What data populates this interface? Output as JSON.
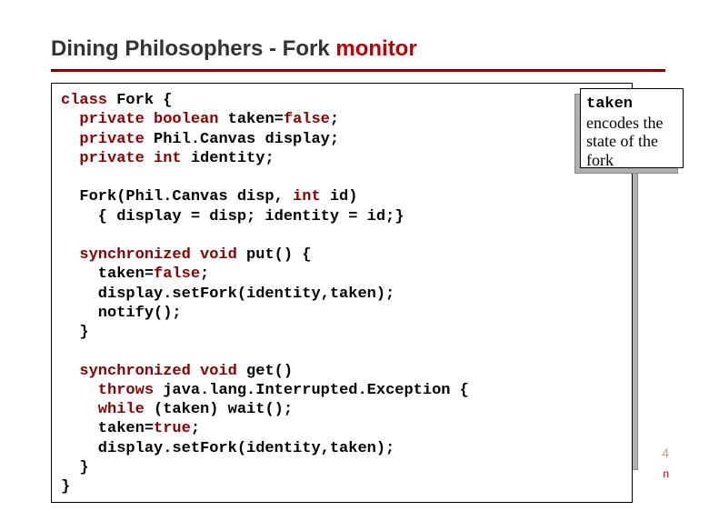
{
  "title": {
    "prefix": "Dining Philosophers - Fork ",
    "highlight": "monitor"
  },
  "code": {
    "l1a": "class",
    "l1b": " Fork {",
    "l2a": "  private",
    "l2b": " ",
    "l2c": "boolean",
    "l2d": " taken=",
    "l2e": "false",
    "l2f": ";",
    "l3a": "  private",
    "l3b": " Phil.Canvas display;",
    "l4a": "  private",
    "l4b": " ",
    "l4c": "int",
    "l4d": " identity;",
    "l5": "",
    "l6a": "  Fork(Phil.Canvas disp, ",
    "l6b": "int",
    "l6c": " id)",
    "l7": "    { display = disp; identity = id;}",
    "l8": "",
    "l9a": "  synchronized",
    "l9b": " ",
    "l9c": "void",
    "l9d": " put() {",
    "l10a": "    taken=",
    "l10b": "false",
    "l10c": ";",
    "l11": "    display.setFork(identity,taken);",
    "l12": "    notify();",
    "l13": "  }",
    "l14": "",
    "l15a": "  synchronized",
    "l15b": " ",
    "l15c": "void",
    "l15d": " get()",
    "l16a": "    throws",
    "l16b": " java.lang.Interrupted.Exception {",
    "l17a": "    while",
    "l17b": " (taken) wait();",
    "l18a": "    taken=",
    "l18b": "true",
    "l18c": ";",
    "l19": "    display.setFork(identity,taken);",
    "l20": "  }",
    "l21": "}"
  },
  "note": {
    "code_word": "taken",
    "rest": " encodes the state of the fork"
  },
  "page_num": "4",
  "foot_mark": "n"
}
